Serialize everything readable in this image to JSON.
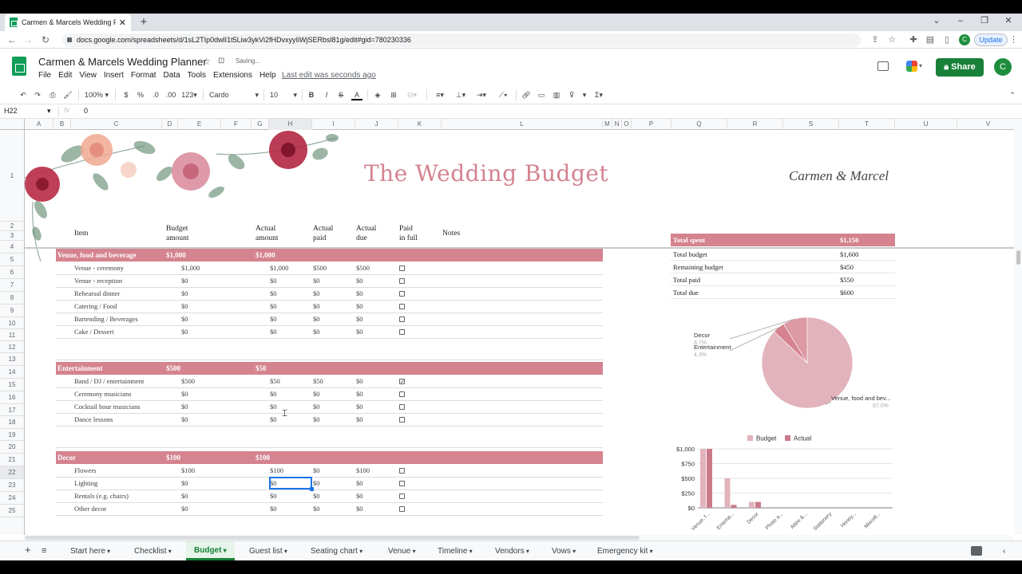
{
  "browser": {
    "tab_title": "Carmen & Marcels Wedding Pla",
    "url": "docs.google.com/spreadsheets/d/1sL2TIp0dwlI1t5Liw3ykVi2fHDvxyyIiWjSERbsl81g/edit#gid=780230336",
    "update_label": "Update",
    "profile_initial": "C"
  },
  "doc": {
    "title": "Carmen & Marcels Wedding Planner",
    "saving": "Saving...",
    "last_edit": "Last edit was seconds ago",
    "share_label": "Share",
    "avatar_initial": "C",
    "menu": [
      "File",
      "Edit",
      "View",
      "Insert",
      "Format",
      "Data",
      "Tools",
      "Extensions",
      "Help"
    ]
  },
  "toolbar": {
    "zoom": "100%",
    "currency": "$",
    "percent": "%",
    "dec_less": ".0",
    "dec_more": ".00",
    "more_formats": "123",
    "font": "Cardo",
    "font_size": "10"
  },
  "formula": {
    "namebox": "H22",
    "fx": "fx",
    "value": "0"
  },
  "columns": [
    "A",
    "B",
    "C",
    "D",
    "E",
    "F",
    "G",
    "H",
    "I",
    "J",
    "K",
    "L",
    "M",
    "N",
    "O",
    "P",
    "Q",
    "R",
    "S",
    "T",
    "U",
    "V"
  ],
  "rows": [
    "1",
    "2",
    "3",
    "4",
    "5",
    "6",
    "7",
    "8",
    "9",
    "10",
    "11",
    "12",
    "13",
    "14",
    "15",
    "16",
    "17",
    "18",
    "19",
    "20",
    "21",
    "22",
    "23",
    "24",
    "25"
  ],
  "sheet": {
    "title": "The Wedding Budget",
    "couple": "Carmen & Marcel",
    "headers": {
      "item": "Item",
      "budget": "Budget\namount",
      "actual": "Actual\namount",
      "paid": "Actual\npaid",
      "due": "Actual\ndue",
      "full": "Paid\nin full",
      "notes": "Notes"
    },
    "categories": [
      {
        "name": "Venue, food and beverage",
        "budget": "$1,000",
        "actual": "$1,000",
        "items": [
          {
            "name": "Venue - ceremony",
            "budget": "$1,000",
            "actual": "$1,000",
            "paid": "$500",
            "due": "$500",
            "full": false
          },
          {
            "name": "Venue - reception",
            "budget": "$0",
            "actual": "$0",
            "paid": "$0",
            "due": "$0",
            "full": false
          },
          {
            "name": "Rehearsal dinner",
            "budget": "$0",
            "actual": "$0",
            "paid": "$0",
            "due": "$0",
            "full": false
          },
          {
            "name": "Catering / Food",
            "budget": "$0",
            "actual": "$0",
            "paid": "$0",
            "due": "$0",
            "full": false
          },
          {
            "name": "Bartending / Beverages",
            "budget": "$0",
            "actual": "$0",
            "paid": "$0",
            "due": "$0",
            "full": false
          },
          {
            "name": "Cake / Dessert",
            "budget": "$0",
            "actual": "$0",
            "paid": "$0",
            "due": "$0",
            "full": false
          }
        ]
      },
      {
        "name": "Entertainment",
        "budget": "$500",
        "actual": "$50",
        "items": [
          {
            "name": "Band / DJ / entertainment",
            "budget": "$500",
            "actual": "$50",
            "paid": "$50",
            "due": "$0",
            "full": true
          },
          {
            "name": "Ceremony musicians",
            "budget": "$0",
            "actual": "$0",
            "paid": "$0",
            "due": "$0",
            "full": false
          },
          {
            "name": "Cocktail hour musicians",
            "budget": "$0",
            "actual": "$0",
            "paid": "$0",
            "due": "$0",
            "full": false
          },
          {
            "name": "Dance lessons",
            "budget": "$0",
            "actual": "$0",
            "paid": "$0",
            "due": "$0",
            "full": false
          }
        ]
      },
      {
        "name": "Decor",
        "budget": "$100",
        "actual": "$100",
        "items": [
          {
            "name": "Flowers",
            "budget": "$100",
            "actual": "$100",
            "paid": "$0",
            "due": "$100",
            "full": false
          },
          {
            "name": "Lighting",
            "budget": "$0",
            "actual": "$0",
            "paid": "$0",
            "due": "$0",
            "full": false
          },
          {
            "name": "Rentals (e.g. chairs)",
            "budget": "$0",
            "actual": "$0",
            "paid": "$0",
            "due": "$0",
            "full": false
          },
          {
            "name": "Other decor",
            "budget": "$0",
            "actual": "$0",
            "paid": "$0",
            "due": "$0",
            "full": false
          }
        ]
      }
    ],
    "summary": {
      "header_label": "Total spent",
      "header_value": "$1,150",
      "rows": [
        {
          "label": "Total budget",
          "value": "$1,600"
        },
        {
          "label": "Remaining budget",
          "value": "$450"
        },
        {
          "label": "Total paid",
          "value": "$550"
        },
        {
          "label": "Total due",
          "value": "$600"
        }
      ]
    }
  },
  "chart_data": [
    {
      "type": "pie",
      "labels": [
        "Venue, food and bev...",
        "Entertainment",
        "Decor"
      ],
      "values": [
        87.0,
        4.3,
        8.7
      ],
      "label_texts": [
        "87.0%",
        "4.3%",
        "8.7%"
      ],
      "colors": [
        "#e2b3bc",
        "#d4838f",
        "#dc9aa5"
      ]
    },
    {
      "type": "bar",
      "categories": [
        "Venue, f...",
        "Entertai...",
        "Decor",
        "Photo a...",
        "Attire &...",
        "Stationery",
        "Honey...",
        "Miscell..."
      ],
      "series": [
        {
          "name": "Budget",
          "values": [
            1000,
            500,
            100,
            0,
            0,
            0,
            0,
            0
          ],
          "color": "#e2b3bc"
        },
        {
          "name": "Actual",
          "values": [
            1000,
            50,
            100,
            0,
            0,
            0,
            0,
            0
          ],
          "color": "#c97a88"
        }
      ],
      "yticks": [
        "$1,000",
        "$750",
        "$500",
        "$250",
        "$0"
      ],
      "ylim": [
        0,
        1000
      ],
      "legend": "top"
    }
  ],
  "sheet_tabs": [
    "Start here",
    "Checklist",
    "Budget",
    "Guest list",
    "Seating chart",
    "Venue",
    "Timeline",
    "Vendors",
    "Vows",
    "Emergency kit"
  ],
  "active_tab": "Budget"
}
